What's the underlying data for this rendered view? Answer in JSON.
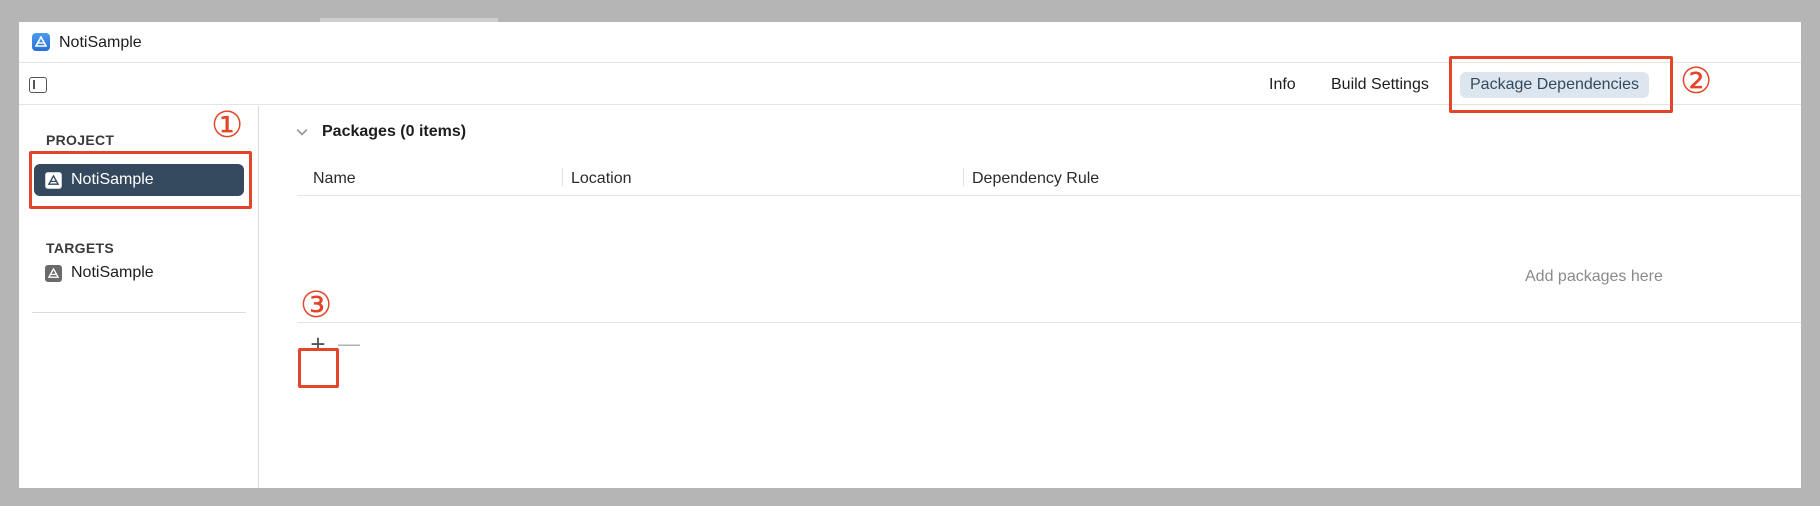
{
  "window": {
    "title": "NotiSample"
  },
  "toolbar": {
    "tabs": [
      {
        "label": "Info"
      },
      {
        "label": "Build Settings"
      },
      {
        "label": "Package Dependencies",
        "selected": true
      }
    ]
  },
  "sidebar": {
    "project_header": "PROJECT",
    "project_item": {
      "label": "NotiSample",
      "selected": true
    },
    "targets_header": "TARGETS",
    "target_item": {
      "label": "NotiSample"
    }
  },
  "packages": {
    "header": "Packages (0 items)",
    "columns": [
      "Name",
      "Location",
      "Dependency Rule"
    ],
    "empty_text": "Add packages here",
    "add_label": "+",
    "remove_label": "—"
  },
  "annotations": [
    "①",
    "②",
    "③"
  ],
  "colors": {
    "annotation": "#e2462a",
    "selected_sidebar": "#34495e",
    "selected_tab_bg": "#dde6ee"
  },
  "icons": [
    "app-icon",
    "sidebar-toggle-icon",
    "chevron-down-icon",
    "project-icon",
    "target-icon"
  ]
}
